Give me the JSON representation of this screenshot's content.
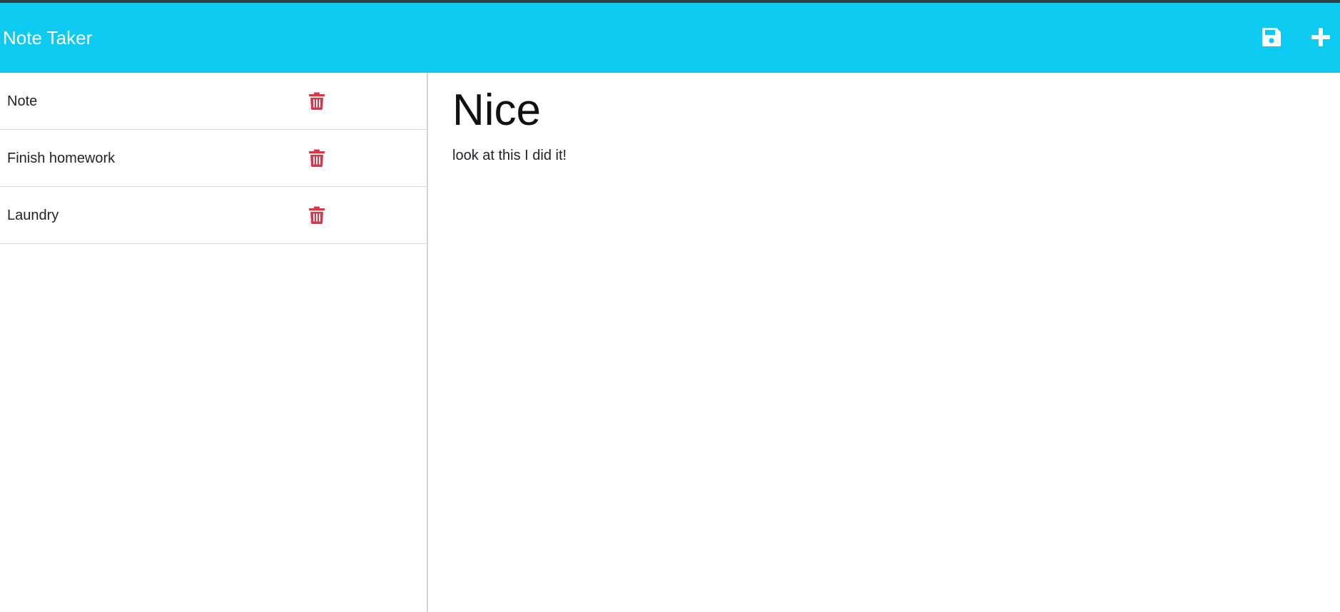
{
  "app": {
    "title": "Note Taker"
  },
  "colors": {
    "navbar": "#0dcaf0",
    "top_strip": "#343a40",
    "delete_icon": "#dc3545",
    "nav_icon": "#ffffff"
  },
  "toolbar": {
    "save_icon": "floppy-disk-icon",
    "new_icon": "plus-icon"
  },
  "notes": [
    {
      "title": "Note",
      "delete_icon": "trash-icon"
    },
    {
      "title": "Finish homework",
      "delete_icon": "trash-icon"
    },
    {
      "title": "Laundry",
      "delete_icon": "trash-icon"
    }
  ],
  "editor": {
    "title_value": "Nice",
    "text_value": "look at this I did it!"
  }
}
